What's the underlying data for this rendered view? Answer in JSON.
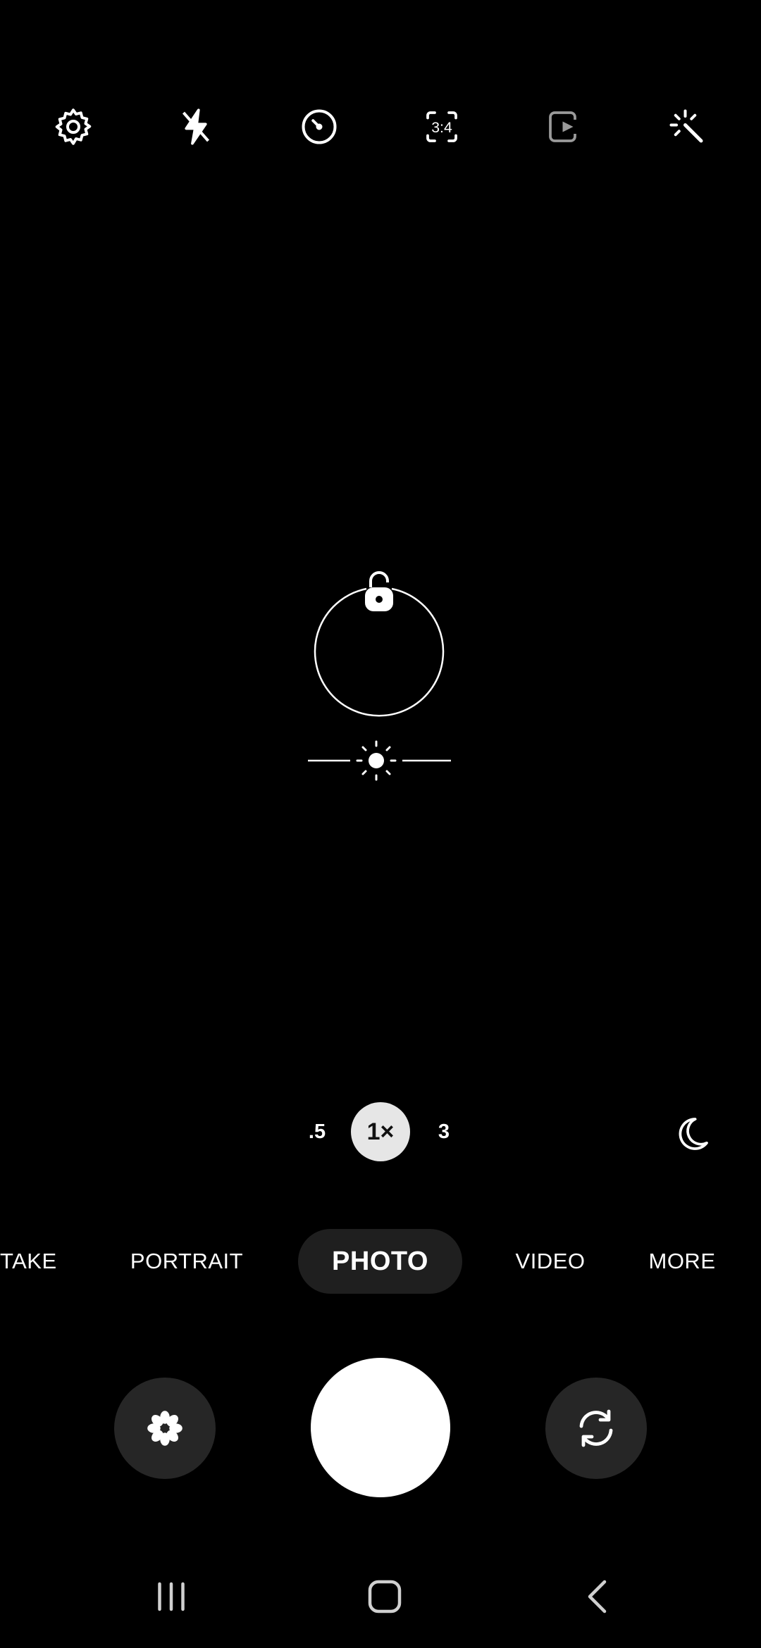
{
  "toolbar": {
    "icons": [
      "settings-icon",
      "flash-off-icon",
      "timer-icon",
      "aspect-ratio-icon",
      "motion-photo-icon",
      "filters-icon"
    ],
    "aspect_ratio_label": "3:4"
  },
  "zoom": {
    "options": [
      ".5",
      "1×",
      "3"
    ],
    "selected": "1×"
  },
  "modes": {
    "items": [
      "TAKE",
      "PORTRAIT",
      "PHOTO",
      "VIDEO",
      "MORE"
    ],
    "selected": "PHOTO"
  },
  "controls": {
    "left_icon": "effects-flower-icon",
    "right_icon": "switch-camera-icon"
  },
  "nav_bar": {
    "icons": [
      "recent-apps-icon",
      "home-icon",
      "back-icon"
    ]
  },
  "colors": {
    "background": "#000000",
    "pill": "#1f1f1f",
    "round_button": "#262626",
    "zoom_active": "#e6e6e6",
    "shutter": "#ffffff"
  }
}
